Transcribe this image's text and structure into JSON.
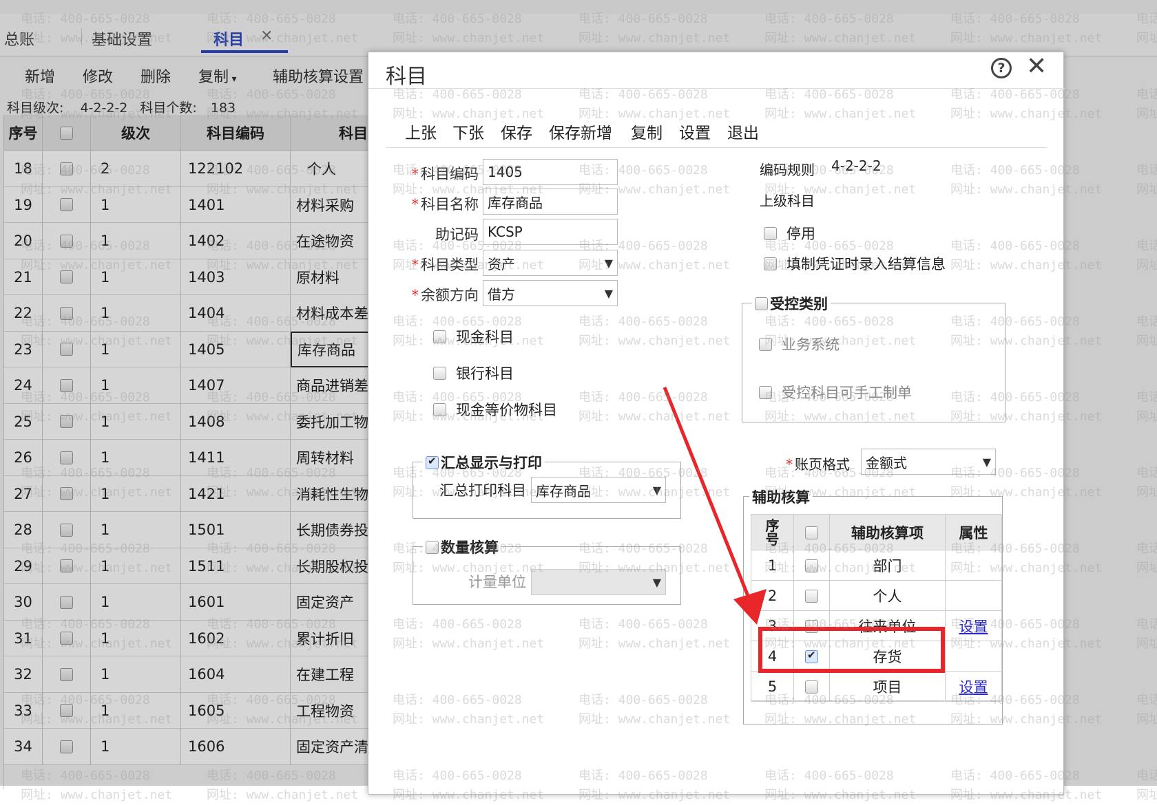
{
  "watermark": {
    "phone": "电话: 400-665-0028",
    "site": "网址: www.chanjet.net"
  },
  "tabs": [
    {
      "label": "总账"
    },
    {
      "label": "基础设置"
    },
    {
      "label": "科目",
      "active": true
    }
  ],
  "tab_close": "✕",
  "toolbar": [
    "新增",
    "修改",
    "删除",
    "复制",
    "辅助核算设置"
  ],
  "info": {
    "level_label": "科目级次:",
    "level": "4-2-2-2",
    "count_label": "科目个数:",
    "count": "183"
  },
  "grid": {
    "headers": [
      "序号",
      "级次",
      "科目编码",
      "科目名称"
    ],
    "rows": [
      {
        "no": "18",
        "level": "2",
        "code": "122102",
        "name": "个人"
      },
      {
        "no": "19",
        "level": "1",
        "code": "1401",
        "name": "材料采购"
      },
      {
        "no": "20",
        "level": "1",
        "code": "1402",
        "name": "在途物资"
      },
      {
        "no": "21",
        "level": "1",
        "code": "1403",
        "name": "原材料"
      },
      {
        "no": "22",
        "level": "1",
        "code": "1404",
        "name": "材料成本差"
      },
      {
        "no": "23",
        "level": "1",
        "code": "1405",
        "name": "库存商品",
        "selected": true
      },
      {
        "no": "24",
        "level": "1",
        "code": "1407",
        "name": "商品进销差"
      },
      {
        "no": "25",
        "level": "1",
        "code": "1408",
        "name": "委托加工物"
      },
      {
        "no": "26",
        "level": "1",
        "code": "1411",
        "name": "周转材料"
      },
      {
        "no": "27",
        "level": "1",
        "code": "1421",
        "name": "消耗性生物"
      },
      {
        "no": "28",
        "level": "1",
        "code": "1501",
        "name": "长期债券投"
      },
      {
        "no": "29",
        "level": "1",
        "code": "1511",
        "name": "长期股权投"
      },
      {
        "no": "30",
        "level": "1",
        "code": "1601",
        "name": "固定资产"
      },
      {
        "no": "31",
        "level": "1",
        "code": "1602",
        "name": "累计折旧"
      },
      {
        "no": "32",
        "level": "1",
        "code": "1604",
        "name": "在建工程"
      },
      {
        "no": "33",
        "level": "1",
        "code": "1605",
        "name": "工程物资"
      },
      {
        "no": "34",
        "level": "1",
        "code": "1606",
        "name": "固定资产清"
      }
    ]
  },
  "dialog": {
    "title": "科目",
    "toolbar": [
      "上张",
      "下张",
      "保存",
      "保存新增",
      "复制",
      "设置",
      "退出"
    ],
    "fields": {
      "code": {
        "label": "科目编码",
        "value": "1405"
      },
      "name": {
        "label": "科目名称",
        "value": "库存商品"
      },
      "mnemonic": {
        "label": "助记码",
        "value": "KCSP"
      },
      "type": {
        "label": "科目类型",
        "value": "资产"
      },
      "direction": {
        "label": "余额方向",
        "value": "借方"
      }
    },
    "checks": {
      "cash": "现金科目",
      "bank": "银行科目",
      "equiv": "现金等价物科目"
    },
    "summary": {
      "legend": "汇总显示与打印",
      "label": "汇总打印科目",
      "value": "库存商品"
    },
    "quantity": {
      "legend": "数量核算",
      "label": "计量单位"
    },
    "right": {
      "rule_label": "编码规则",
      "rule": "4-2-2-2",
      "parent_label": "上级科目",
      "disable": "停用",
      "settle": "填制凭证时录入结算信息"
    },
    "controlled": {
      "legend": "受控类别",
      "items": [
        "业务系统",
        "受控科目可手工制单"
      ]
    },
    "ledger": {
      "label": "账页格式",
      "value": "金额式"
    },
    "aux": {
      "legend": "辅助核算",
      "headers": [
        "序\n号",
        "辅助核算项",
        "属性"
      ],
      "rows": [
        {
          "no": "1",
          "name": "部门",
          "attr": "",
          "checked": false
        },
        {
          "no": "2",
          "name": "个人",
          "attr": "",
          "checked": false
        },
        {
          "no": "3",
          "name": "往来单位",
          "attr": "设置",
          "checked": false
        },
        {
          "no": "4",
          "name": "存货",
          "attr": "",
          "checked": true
        },
        {
          "no": "5",
          "name": "项目",
          "attr": "设置",
          "checked": false
        }
      ]
    },
    "highlight_color": "#e8262a"
  }
}
